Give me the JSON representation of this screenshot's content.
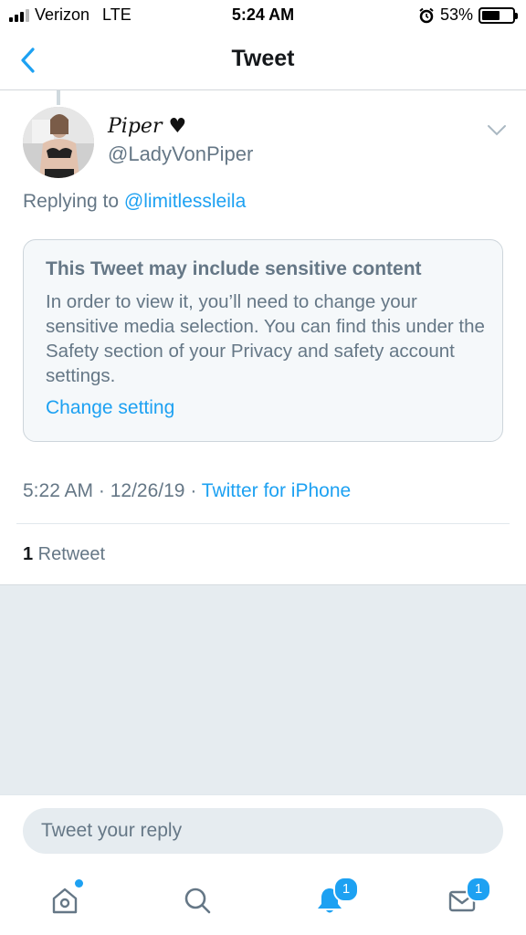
{
  "status_bar": {
    "carrier": "Verizon",
    "network": "LTE",
    "time": "5:24 AM",
    "battery": "53%",
    "battery_level": 0.53
  },
  "nav": {
    "title": "Tweet"
  },
  "tweet": {
    "display_name": "Piper ♥",
    "handle": "@LadyVonPiper",
    "replying_label": "Replying to",
    "replying_to": "@limitlessleila",
    "sensitive": {
      "title": "This Tweet may include sensitive content",
      "body": "In order to view it, you’ll need to change your sensitive media selection. You can find this under the Safety section of your Privacy and safety account settings.",
      "link": "Change setting"
    },
    "meta": {
      "time": "5:22 AM",
      "separator": " · ",
      "date": "12/26/19",
      "client": "Twitter for iPhone"
    },
    "retweet_count": "1",
    "retweet_label": " Retweet"
  },
  "reply": {
    "placeholder": "Tweet your reply"
  },
  "tabbar": {
    "notifications_badge": "1",
    "messages_badge": "1"
  },
  "colors": {
    "accent": "#1da1f2",
    "secondary_text": "#657786",
    "background_gray": "#e6ecf0"
  }
}
